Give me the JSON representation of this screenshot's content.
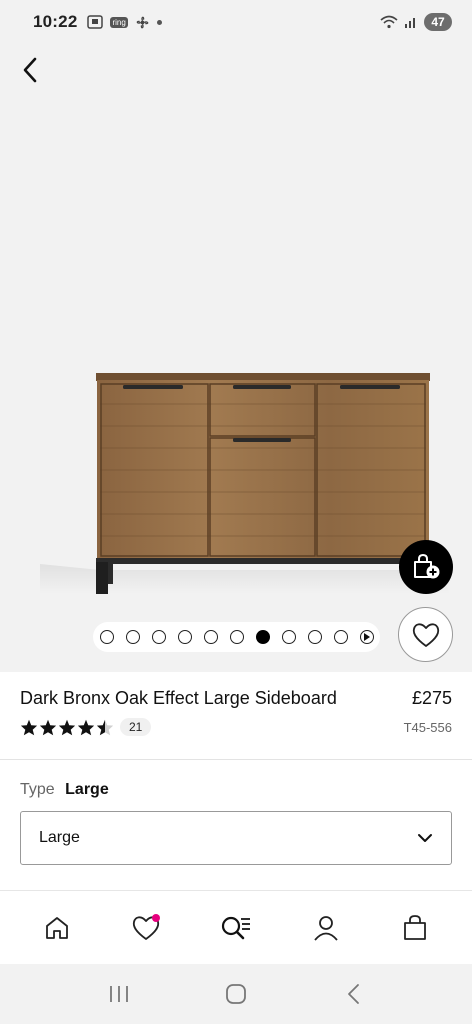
{
  "status_bar": {
    "time": "10:22",
    "battery": "47"
  },
  "product": {
    "title": "Dark Bronx Oak Effect Large Sideboard",
    "price": "£275",
    "rating": 4.5,
    "review_count": "21",
    "sku": "T45-556"
  },
  "gallery": {
    "image_count": 10,
    "active_index": 6
  },
  "options": {
    "type_label": "Type",
    "type_value": "Large",
    "select_value": "Large"
  },
  "bottom_nav": {
    "items": [
      "home-icon",
      "heart-icon",
      "search-icon",
      "account-icon",
      "bag-icon"
    ],
    "wishlist_indicator_color": "#e6007e"
  },
  "colors": {
    "accent": "#000000",
    "background": "#f2f2f2"
  }
}
